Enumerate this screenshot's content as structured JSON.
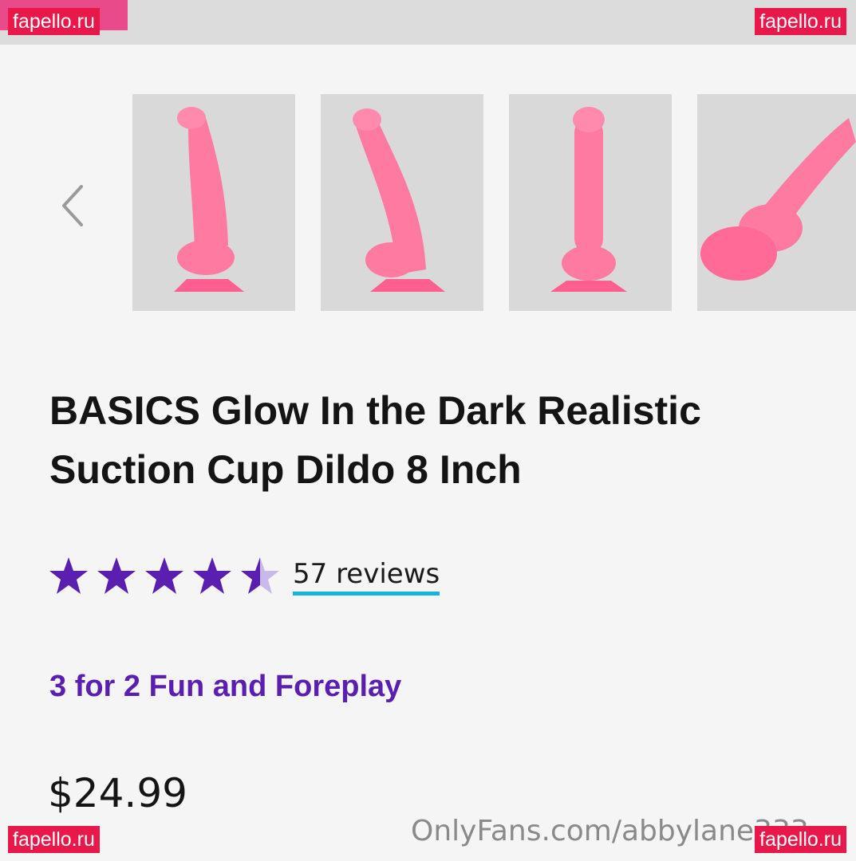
{
  "watermarks": {
    "top_left": "fapello.ru",
    "top_right": "fapello.ru",
    "bottom_left": "fapello.ru",
    "bottom_right": "fapello.ru",
    "onlyfans": "OnlyFans.com/abbylane333"
  },
  "gallery": {
    "selected_index": 0,
    "thumbnails": [
      {
        "icon": "product-image-front"
      },
      {
        "icon": "product-image-side"
      },
      {
        "icon": "product-image-back"
      },
      {
        "icon": "product-image-angle"
      }
    ],
    "prev_icon": "chevron-left-icon"
  },
  "product": {
    "title": "BASICS Glow In the Dark Realistic Suction Cup Dildo 8 Inch",
    "rating": 4.5,
    "rating_max": 5,
    "reviews_label": "57 reviews",
    "promo": "3 for 2 Fun and Foreplay",
    "price": "$24.99"
  },
  "colors": {
    "accent_purple": "#5a1fb0",
    "star_filled": "#5a1fb0",
    "star_empty": "#c9b8ea",
    "underline": "#18b4e0",
    "product_pink": "#ff6f9a"
  }
}
